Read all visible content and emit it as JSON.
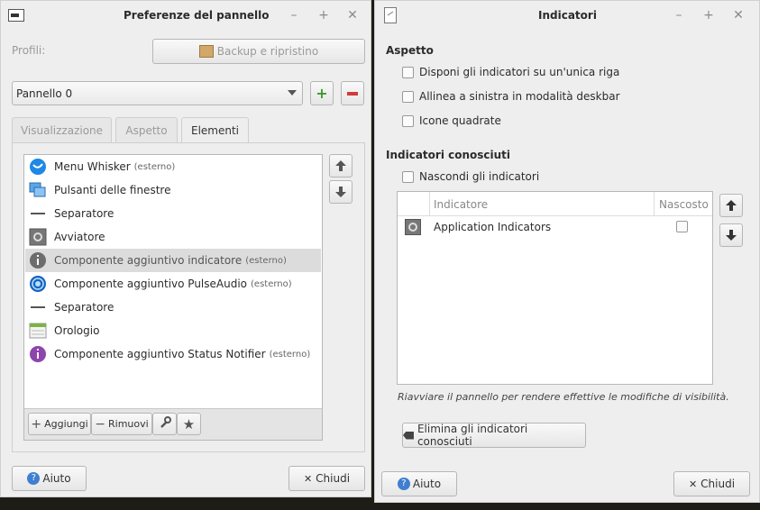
{
  "left_window": {
    "title": "Preferenze del pannello",
    "profiles_label": "Profili:",
    "backup_button": "Backup e ripristino",
    "panel_select": "Pannello 0",
    "tabs": [
      {
        "label": "Visualizzazione"
      },
      {
        "label": "Aspetto"
      },
      {
        "label": "Elementi"
      }
    ],
    "items": [
      {
        "label": "Menu Whisker",
        "ext": "(esterno)",
        "icon": "whisker-menu-icon"
      },
      {
        "label": "Pulsanti delle finestre",
        "ext": "",
        "icon": "window-buttons-icon"
      },
      {
        "label": "Separatore",
        "ext": "",
        "icon": "separator-icon"
      },
      {
        "label": "Avviatore",
        "ext": "",
        "icon": "launcher-icon"
      },
      {
        "label": "Componente aggiuntivo indicatore",
        "ext": "(esterno)",
        "icon": "indicator-icon"
      },
      {
        "label": "Componente aggiuntivo PulseAudio",
        "ext": "(esterno)",
        "icon": "pulseaudio-icon"
      },
      {
        "label": "Separatore",
        "ext": "",
        "icon": "separator-icon"
      },
      {
        "label": "Orologio",
        "ext": "",
        "icon": "clock-icon"
      },
      {
        "label": "Componente aggiuntivo Status Notifier",
        "ext": "(esterno)",
        "icon": "status-notifier-icon"
      }
    ],
    "add_button": "Aggiungi",
    "remove_button": "Rimuovi",
    "help_button": "Aiuto",
    "close_button": "Chiudi"
  },
  "right_window": {
    "title": "Indicatori",
    "appearance_heading": "Aspetto",
    "options": [
      {
        "label": "Disponi gli indicatori su un'unica riga",
        "checked": false
      },
      {
        "label": "Allinea a sinistra in modalità deskbar",
        "checked": false
      },
      {
        "label": "Icone quadrate",
        "checked": false
      }
    ],
    "known_heading": "Indicatori conosciuti",
    "hide_label": "Nascondi gli indicatori",
    "table": {
      "col_indicator": "Indicatore",
      "col_hidden": "Nascosto",
      "rows": [
        {
          "name": "Application Indicators",
          "hidden": false
        }
      ]
    },
    "note": "Riavviare il pannello per rendere effettive le modifiche di visibilità.",
    "clear_button": "Elimina gli indicatori conosciuti",
    "help_button": "Aiuto",
    "close_button": "Chiudi"
  },
  "colors": {
    "accent_green": "#4caf50",
    "accent_red": "#e53935",
    "selection": "#dcdcdc"
  }
}
